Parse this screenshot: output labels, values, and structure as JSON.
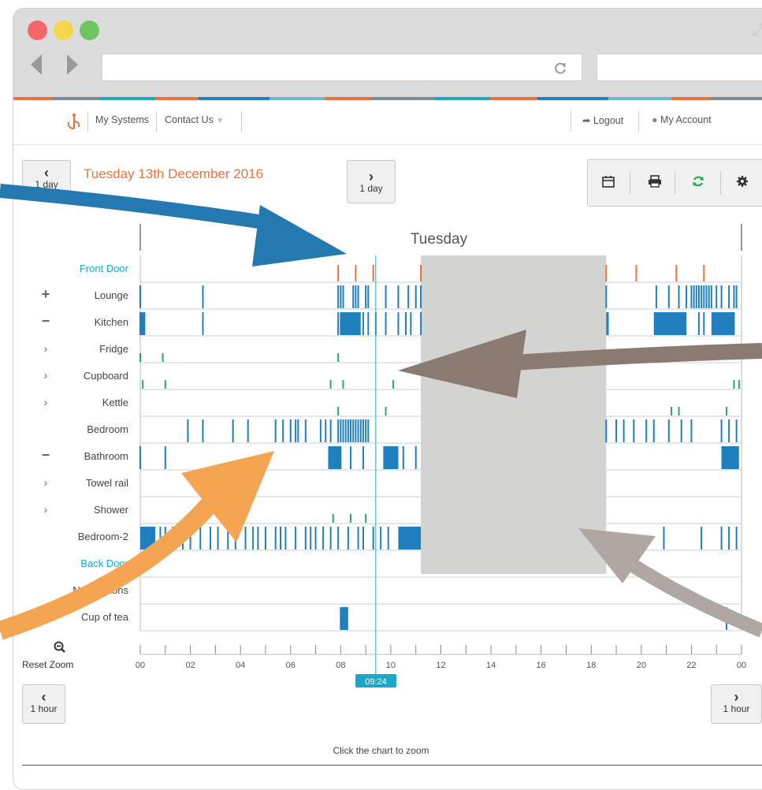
{
  "browser": {
    "url": "",
    "reload_icon": "reload-icon",
    "colors": {
      "close": "#f2686a",
      "minimize": "#f5d54a",
      "maximize": "#6cc55f"
    }
  },
  "nav": {
    "systems": "My Systems",
    "contact": "Contact Us",
    "logout": "Logout",
    "account": "My Account"
  },
  "date_nav": {
    "title": "Tuesday 13th December 2016",
    "prev_day": "1 day",
    "next_day": "1 day",
    "prev_hour": "1 hour",
    "next_hour": "1 hour"
  },
  "tools": [
    "calendar-icon",
    "print-icon",
    "refresh-icon",
    "settings-icon"
  ],
  "chart_data": {
    "type": "timeline",
    "title": "Tuesday",
    "xlabel": "",
    "x_ticks": [
      "00",
      "02",
      "04",
      "06",
      "08",
      "10",
      "12",
      "14",
      "16",
      "18",
      "20",
      "22",
      "00"
    ],
    "x_range_hours": [
      0,
      24
    ],
    "cursor_time": "09:24",
    "cursor_hour": 9.4,
    "shaded_range_hours": [
      11.2,
      18.6
    ],
    "rows": [
      {
        "label": "Front Door",
        "kind": "door",
        "color": "#e8733d",
        "events": [
          7.9,
          8.6,
          9.3,
          11.2,
          18.6,
          19.8,
          21.4,
          22.5
        ]
      },
      {
        "label": "Lounge",
        "control": "+",
        "color": "#1f7fbf",
        "events": [
          0.0,
          2.5,
          7.9,
          8.0,
          8.1,
          8.5,
          8.6,
          8.7,
          9.0,
          9.1,
          9.8,
          10.3,
          10.7,
          11.0,
          11.2,
          18.6,
          20.6,
          21.1,
          21.5,
          21.8,
          22.0,
          22.1,
          22.2,
          22.3,
          22.4,
          22.5,
          22.6,
          22.7,
          22.8,
          23.0,
          23.2,
          23.5,
          23.7,
          23.8
        ],
        "blocks": []
      },
      {
        "label": "Kitchen",
        "control": "−",
        "color": "#1f7fbf",
        "events": [
          0.0,
          0.1,
          2.5,
          7.9,
          8.0,
          8.2,
          8.4,
          8.6,
          8.9,
          9.1,
          9.4,
          9.8,
          10.3,
          10.6,
          10.8,
          11.2,
          22.3,
          22.5,
          22.9,
          23.2,
          23.5,
          23.7
        ],
        "blocks": [
          [
            0.0,
            0.2
          ],
          [
            8.0,
            8.8
          ],
          [
            18.6,
            18.7
          ],
          [
            20.5,
            21.8
          ],
          [
            22.8,
            23.7
          ]
        ]
      },
      {
        "label": "Fridge",
        "control": ">",
        "color": "#27a86e",
        "events": [
          0.0,
          0.9,
          7.9
        ]
      },
      {
        "label": "Cupboard",
        "control": ">",
        "color": "#27a86e",
        "events": [
          0.1,
          1.0,
          7.6,
          8.1,
          10.1,
          23.7,
          23.9
        ]
      },
      {
        "label": "Kettle",
        "control": ">",
        "color": "#27a86e",
        "events": [
          7.9,
          9.8,
          21.2,
          21.5,
          23.4
        ]
      },
      {
        "label": "Bedroom",
        "color": "#1f7fbf",
        "events": [
          1.9,
          2.5,
          3.7,
          4.3,
          5.4,
          5.7,
          6.0,
          6.2,
          6.3,
          6.6,
          7.2,
          7.4,
          7.6,
          7.9,
          8.0,
          8.1,
          8.2,
          8.3,
          8.4,
          8.5,
          8.6,
          8.7,
          8.8,
          8.9,
          9.0,
          9.1,
          18.6,
          19.0,
          19.3,
          19.7,
          20.2,
          20.5,
          21.1,
          21.6,
          22.0,
          23.2,
          23.5,
          23.8
        ]
      },
      {
        "label": "Bathroom",
        "control": "−",
        "color": "#1f7fbf",
        "events": [
          0.0,
          1.0,
          7.6,
          7.8,
          8.0,
          8.4,
          8.9,
          9.8,
          10.5,
          11.0
        ],
        "blocks": [
          [
            7.5,
            8.0
          ],
          [
            9.7,
            10.3
          ],
          [
            23.2,
            23.9
          ]
        ]
      },
      {
        "label": "Towel rail",
        "control": ">",
        "color": "#27a86e",
        "events": []
      },
      {
        "label": "Shower",
        "control": ">",
        "color": "#27a86e",
        "events": [
          7.7,
          8.4,
          9.0
        ]
      },
      {
        "label": "Bedroom-2",
        "color": "#1f7fbf",
        "events": [
          0.2,
          0.5,
          0.8,
          1.0,
          1.3,
          1.7,
          2.0,
          2.4,
          2.8,
          3.1,
          3.5,
          3.8,
          4.2,
          4.5,
          4.7,
          5.0,
          5.4,
          5.6,
          5.8,
          6.2,
          6.6,
          6.8,
          7.0,
          7.3,
          7.6,
          7.9,
          8.3,
          8.7,
          8.9,
          9.3,
          9.6,
          9.9,
          20.9,
          22.4,
          23.2,
          23.5,
          23.8
        ],
        "blocks": [
          [
            0.0,
            0.6
          ],
          [
            10.3,
            11.2
          ]
        ]
      },
      {
        "label": "Back Door",
        "kind": "door",
        "color": "#e8733d",
        "events": []
      },
      {
        "label": "Notifications",
        "color": "#1f7fbf",
        "events": []
      },
      {
        "label": "Cup of tea",
        "color": "#1f7fbf",
        "events": [
          8.0,
          8.2,
          23.4
        ],
        "blocks": [
          [
            8.0,
            8.3
          ]
        ]
      }
    ]
  },
  "reset_zoom": "Reset Zoom",
  "hint": "Click the chart to zoom"
}
